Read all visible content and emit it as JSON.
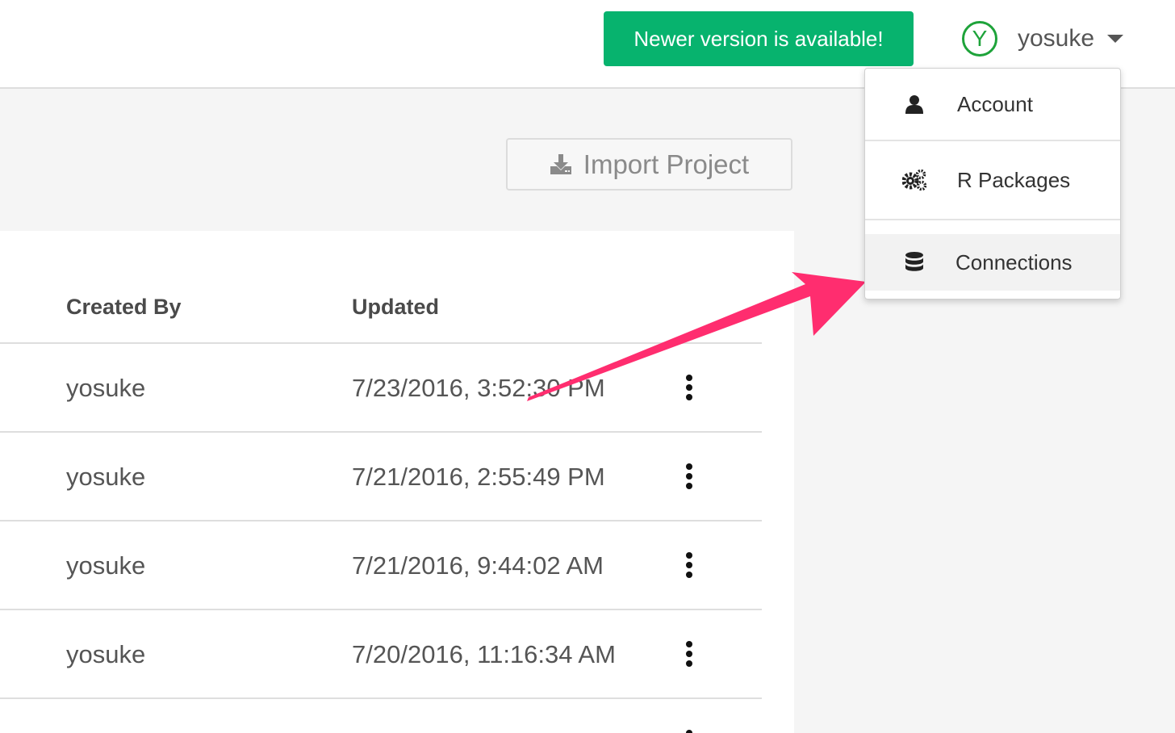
{
  "header": {
    "update_notice": "Newer version is available!",
    "user": {
      "initial": "Y",
      "name": "yosuke"
    }
  },
  "toolbar": {
    "import_label": "Import Project"
  },
  "table": {
    "columns": [
      "Created By",
      "Updated"
    ],
    "rows": [
      {
        "created_by": "yosuke",
        "updated": "7/23/2016, 3:52:30 PM"
      },
      {
        "created_by": "yosuke",
        "updated": "7/21/2016, 2:55:49 PM"
      },
      {
        "created_by": "yosuke",
        "updated": "7/21/2016, 9:44:02 AM"
      },
      {
        "created_by": "yosuke",
        "updated": "7/20/2016, 11:16:34 AM"
      }
    ]
  },
  "user_menu": {
    "items": [
      {
        "label": "Account",
        "icon": "user-icon"
      },
      {
        "label": "R Packages",
        "icon": "gears-icon"
      },
      {
        "label": "Connections",
        "icon": "database-icon",
        "highlighted": true
      }
    ]
  },
  "colors": {
    "update_green": "#07b36e",
    "avatar_green": "#1ea33a",
    "annotation_arrow": "#ff2d6f"
  }
}
